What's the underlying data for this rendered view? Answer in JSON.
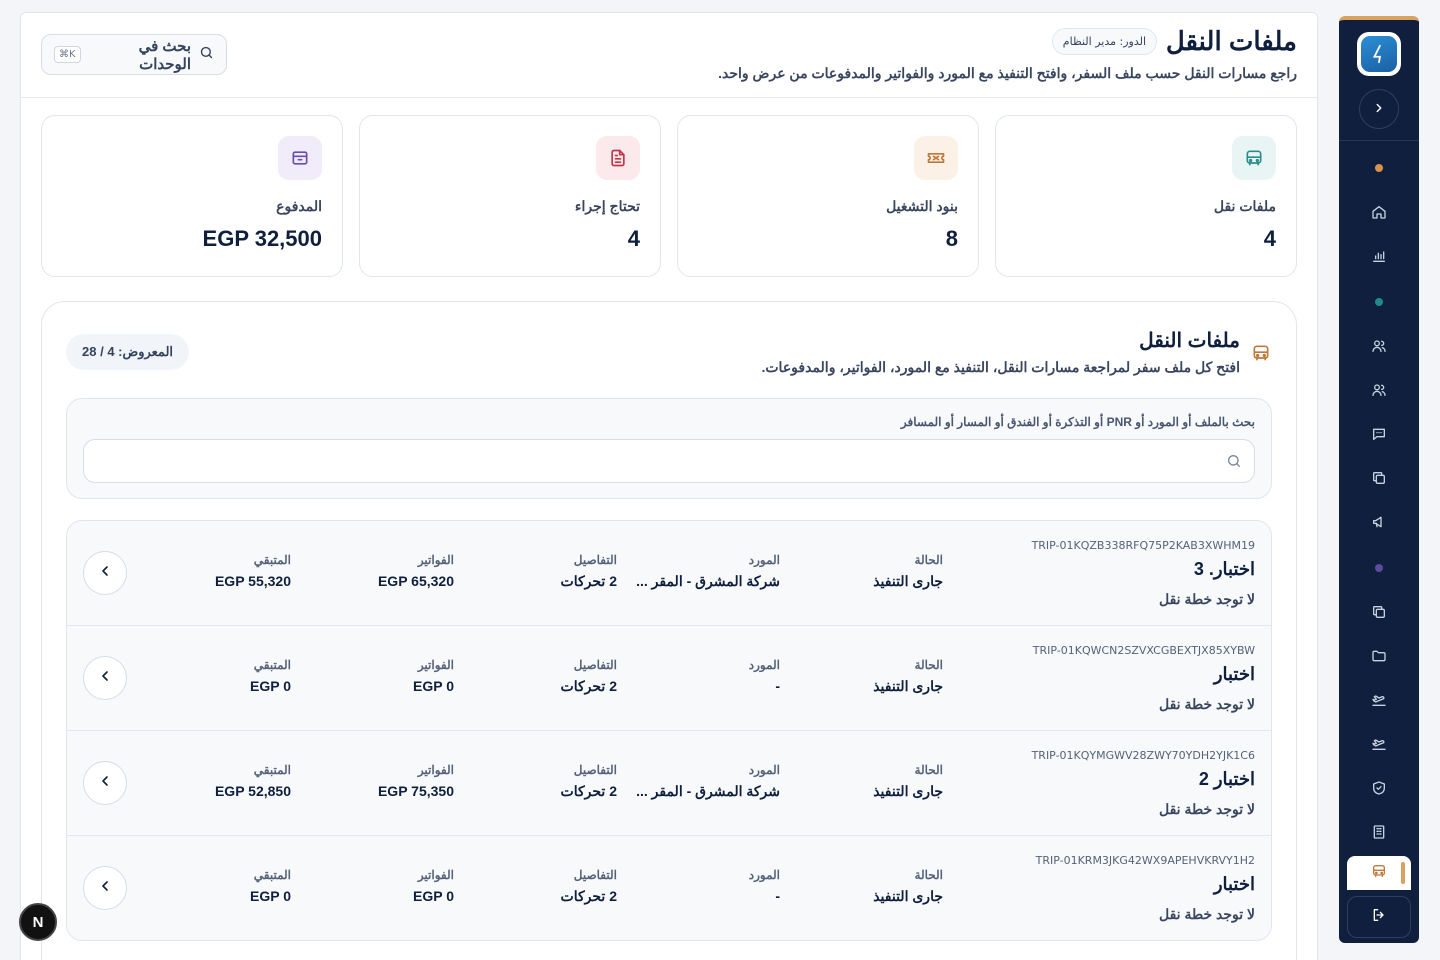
{
  "header": {
    "title": "ملفات النقل",
    "role": "الدور: مدير النظام",
    "subtitle": "راجع مسارات النقل حسب ملف السفر، وافتح التنفيذ مع المورد والفواتير والمدفوعات من عرض واحد.",
    "unit_search": {
      "label": "بحث في الوحدات",
      "shortcut": "⌘K"
    }
  },
  "stats": [
    {
      "label": "ملفات نقل",
      "value": "4",
      "icon": "bus-icon",
      "accent": "#2a8c8c"
    },
    {
      "label": "بنود التشغيل",
      "value": "8",
      "icon": "ticket-icon",
      "accent": "#c0773a"
    },
    {
      "label": "تحتاج إجراء",
      "value": "4",
      "icon": "document-icon",
      "accent": "#c2364a"
    },
    {
      "label": "المدفوع",
      "value": "EGP 32,500",
      "icon": "wallet-icon",
      "accent": "#6b4bb5"
    }
  ],
  "files": {
    "title": "ملفات النقل",
    "subtitle": "افتح كل ملف سفر لمراجعة مسارات النقل، التنفيذ مع المورد، الفواتير، والمدفوعات.",
    "shown": "المعروض: 4 / 28",
    "search_label": "بحث بالملف أو المورد أو PNR أو التذكرة أو الفندق أو المسار أو المسافر",
    "search_value": "",
    "columns": {
      "status": "الحالة",
      "vendor": "المورد",
      "details": "التفاصيل",
      "invoices": "الفواتير",
      "remaining": "المتبقي"
    },
    "rows": [
      {
        "code": "TRIP-01KQZB338RFQ75P2KAB3XWHM19",
        "name": "اختبار. 3",
        "plan": "لا توجد خطة نقل",
        "status": "جارى التنفيذ",
        "vendor": "شركة المشرق - المقر ...",
        "details": "2 تحركات",
        "invoices": "EGP 65,320",
        "remaining": "EGP 55,320"
      },
      {
        "code": "TRIP-01KQWCN2SZVXCGBEXTJX85XYBW",
        "name": "اختبار",
        "plan": "لا توجد خطة نقل",
        "status": "جارى التنفيذ",
        "vendor": "-",
        "details": "2 تحركات",
        "invoices": "EGP 0",
        "remaining": "EGP 0"
      },
      {
        "code": "TRIP-01KQYMGWV28ZWY70YDH2YJK1C6",
        "name": "اختبار 2",
        "plan": "لا توجد خطة نقل",
        "status": "جارى التنفيذ",
        "vendor": "شركة المشرق - المقر ...",
        "details": "2 تحركات",
        "invoices": "EGP 75,350",
        "remaining": "EGP 52,850"
      },
      {
        "code": "TRIP-01KRM3JKG42WX9APEHVKRVY1H2",
        "name": "اختبار",
        "plan": "لا توجد خطة نقل",
        "status": "جارى التنفيذ",
        "vendor": "-",
        "details": "2 تحركات",
        "invoices": "EGP 0",
        "remaining": "EGP 0"
      }
    ]
  },
  "sidebar": {
    "items": [
      "dot-orange",
      "home-icon",
      "chart-icon",
      "dot-teal",
      "users-icon",
      "users-icon",
      "chat-icon",
      "copy-icon",
      "megaphone-icon",
      "dot-purple",
      "copy-icon",
      "folder-icon",
      "flight-icon",
      "flight-icon",
      "shield-check-icon",
      "building-icon",
      "bus-icon"
    ],
    "active": "bus-icon",
    "logout": "logout-icon"
  },
  "dev_badge": "N"
}
